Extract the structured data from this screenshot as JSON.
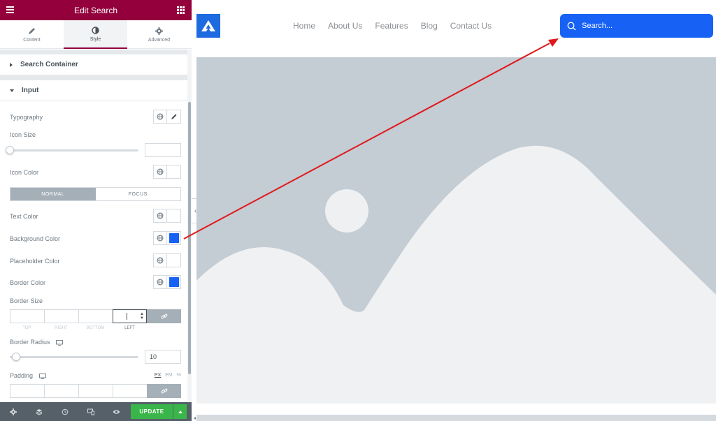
{
  "panel": {
    "title": "Edit Search",
    "tabs": [
      {
        "label": "Content",
        "icon": "pencil-icon",
        "active": false
      },
      {
        "label": "Style",
        "icon": "half-circle-icon",
        "active": true
      },
      {
        "label": "Advanced",
        "icon": "gear-icon",
        "active": false
      }
    ],
    "sections": {
      "search_container": "Search Container",
      "input": "Input"
    },
    "controls": {
      "typography": "Typography",
      "icon_size": "Icon Size",
      "icon_color": "Icon Color",
      "state_normal": "NORMAL",
      "state_focus": "FOCUS",
      "text_color": "Text Color",
      "background_color": "Background Color",
      "placeholder_color": "Placeholder Color",
      "border_color": "Border Color",
      "border_size": "Border Size",
      "border_radius": "Border Radius",
      "border_radius_value": "10",
      "padding": "Padding",
      "dim_top": "TOP",
      "dim_right": "RIGHT",
      "dim_bottom": "BOTTOM",
      "dim_left": "LEFT",
      "unit_px": "PX",
      "unit_em": "EM",
      "unit_pct": "%"
    },
    "colors": {
      "background_color": "#1762f5",
      "border_color": "#1762f5",
      "brand": "#93003c"
    },
    "footer": {
      "update_label": "UPDATE"
    }
  },
  "preview": {
    "nav": [
      "Home",
      "About Us",
      "Features",
      "Blog",
      "Contact Us"
    ],
    "search_placeholder": "Search..."
  }
}
